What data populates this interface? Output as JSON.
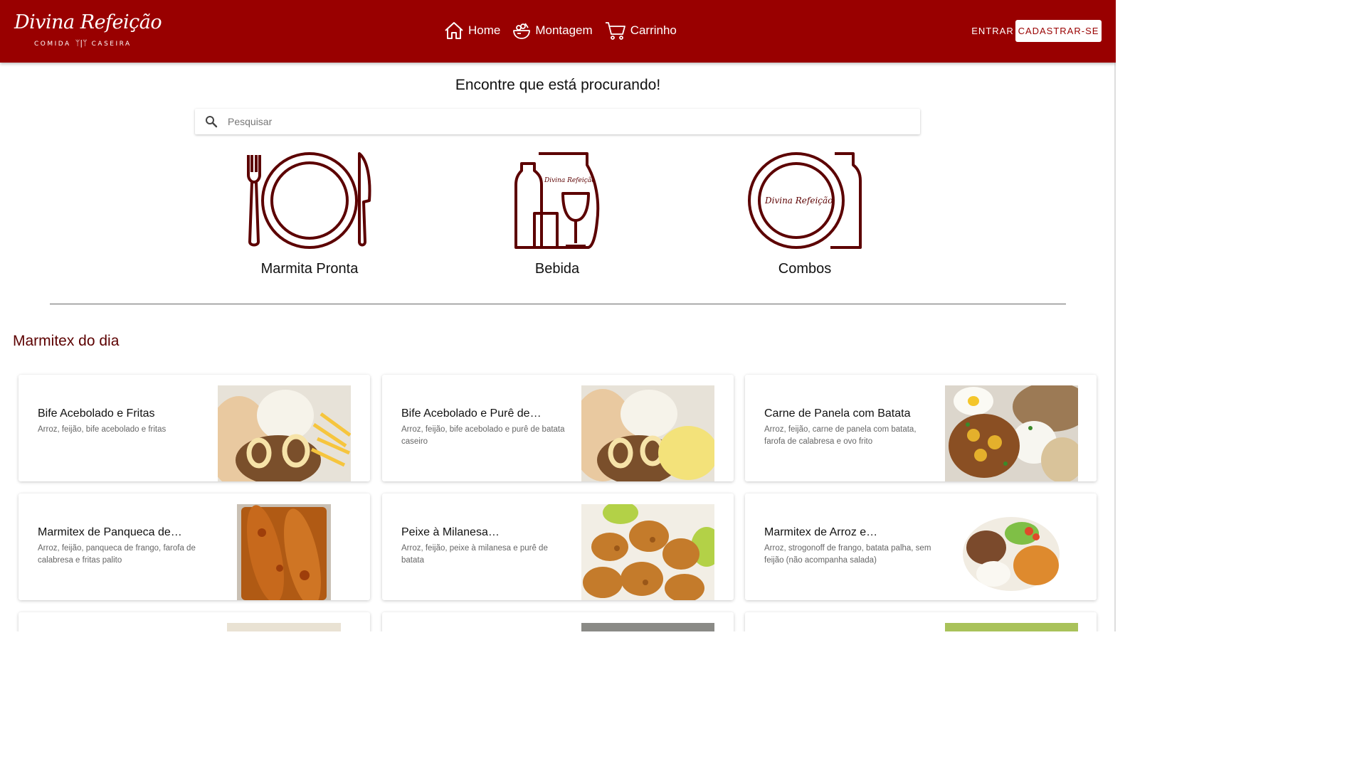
{
  "header": {
    "logo_script": "Divina Refeição",
    "logo_sub_left": "COMIDA",
    "logo_sub_right": "CASEIRA",
    "nav": [
      {
        "label": "Home",
        "icon": "home-icon"
      },
      {
        "label": "Montagem",
        "icon": "salad-bowl-icon"
      },
      {
        "label": "Carrinho",
        "icon": "cart-icon"
      }
    ],
    "login_label": "ENTRAR",
    "signup_label": "CADASTRAR-SE",
    "brand_color": "#990000"
  },
  "search": {
    "headline": "Encontre que está procurando!",
    "placeholder": "Pesquisar",
    "icon": "search-icon"
  },
  "categories": [
    {
      "label": "Marmita Pronta",
      "icon": "plate-cutlery-icon"
    },
    {
      "label": "Bebida",
      "icon": "drinks-icon",
      "badge_text": "Divina Refeição"
    },
    {
      "label": "Combos",
      "icon": "plate-bottle-icon",
      "badge_text": "Divina Refeição"
    }
  ],
  "section": {
    "title": "Marmitex do dia",
    "accent_color": "#5c0000"
  },
  "products": [
    {
      "title": "Bife Acebolado e Fritas",
      "description": "Arroz, feijão, bife acebolado e fritas"
    },
    {
      "title": "Bife Acebolado e Purê de…",
      "description": "Arroz, feijão, bife acebolado e purê de batata caseiro"
    },
    {
      "title": "Carne de Panela com Batata",
      "description": "Arroz, feijão, carne de panela com batata, farofa de calabresa e ovo frito"
    },
    {
      "title": "Marmitex de Panqueca de…",
      "description": "Arroz, feijão, panqueca de frango, farofa de calabresa e fritas palito"
    },
    {
      "title": "Peixe à Milanesa…",
      "description": "Arroz, feijão, peixe à milanesa e purê de batata"
    },
    {
      "title": "Marmitex de Arroz e…",
      "description": "Arroz, strogonoff de frango, batata palha, sem feijão (não acompanha salada)"
    }
  ]
}
